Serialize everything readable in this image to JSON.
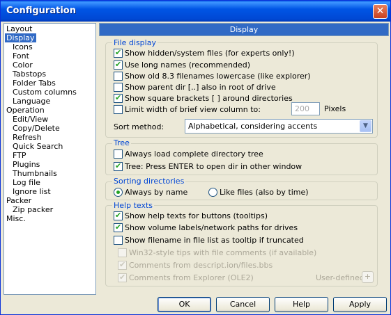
{
  "window": {
    "title": "Configuration",
    "close_glyph": "✕"
  },
  "tree": {
    "items": [
      {
        "label": "Layout"
      },
      {
        "label": "Display",
        "selected": true
      },
      {
        "label": "Icons"
      },
      {
        "label": "Font"
      },
      {
        "label": "Color"
      },
      {
        "label": "Tabstops"
      },
      {
        "label": "Folder Tabs"
      },
      {
        "label": "Custom columns"
      },
      {
        "label": "Language"
      },
      {
        "label": "Operation"
      },
      {
        "label": "Edit/View"
      },
      {
        "label": "Copy/Delete"
      },
      {
        "label": "Refresh"
      },
      {
        "label": "Quick Search"
      },
      {
        "label": "FTP"
      },
      {
        "label": "Plugins"
      },
      {
        "label": "Thumbnails"
      },
      {
        "label": "Log file"
      },
      {
        "label": "Ignore list"
      },
      {
        "label": "Packer"
      },
      {
        "label": "Zip packer"
      },
      {
        "label": "Misc."
      }
    ]
  },
  "panel": {
    "header": "Display"
  },
  "file_display": {
    "title": "File display",
    "options": [
      {
        "label": "Show hidden/system files (for experts only!)",
        "checked": true
      },
      {
        "label": "Use long names (recommended)",
        "checked": true
      },
      {
        "label": "Show old 8.3 filenames lowercase (like explorer)",
        "checked": false
      },
      {
        "label": "Show parent dir [..] also in root of drive",
        "checked": false
      },
      {
        "label": "Show square brackets [ ] around directories",
        "checked": true
      },
      {
        "label": "Limit width of brief view column to:",
        "checked": false
      }
    ],
    "width_value": "200",
    "width_unit": "Pixels",
    "sort_label": "Sort method:",
    "sort_value": "Alphabetical, considering accents"
  },
  "tree_group": {
    "title": "Tree",
    "options": [
      {
        "label": "Always load complete directory tree",
        "checked": false
      },
      {
        "label": "Tree: Press ENTER to open dir in other window",
        "checked": true
      }
    ]
  },
  "sorting": {
    "title": "Sorting directories",
    "options": [
      {
        "label": "Always by name",
        "selected": true
      },
      {
        "label": "Like files (also by time)",
        "selected": false
      }
    ]
  },
  "help_texts": {
    "title": "Help texts",
    "options": [
      {
        "label": "Show help texts for buttons (tooltips)",
        "checked": true,
        "enabled": true
      },
      {
        "label": "Show volume labels/network paths for drives",
        "checked": true,
        "enabled": true
      },
      {
        "label": "Show filename in file list as tooltip if truncated",
        "checked": false,
        "enabled": true
      },
      {
        "label": "Win32-style tips with file comments (if available)",
        "checked": false,
        "enabled": false
      },
      {
        "label": "Comments from descript.ion/files.bbs",
        "checked": true,
        "enabled": false
      },
      {
        "label": "Comments from Explorer (OLE2)",
        "checked": true,
        "enabled": false
      }
    ],
    "user_defined_label": "User-defined:",
    "plus_label": "+"
  },
  "buttons": {
    "ok": "OK",
    "cancel": "Cancel",
    "help": "Help",
    "apply": "Apply"
  },
  "colors": {
    "accent": "#316ac5",
    "group_title": "#0046d5",
    "titlebar": "#0055e5"
  }
}
